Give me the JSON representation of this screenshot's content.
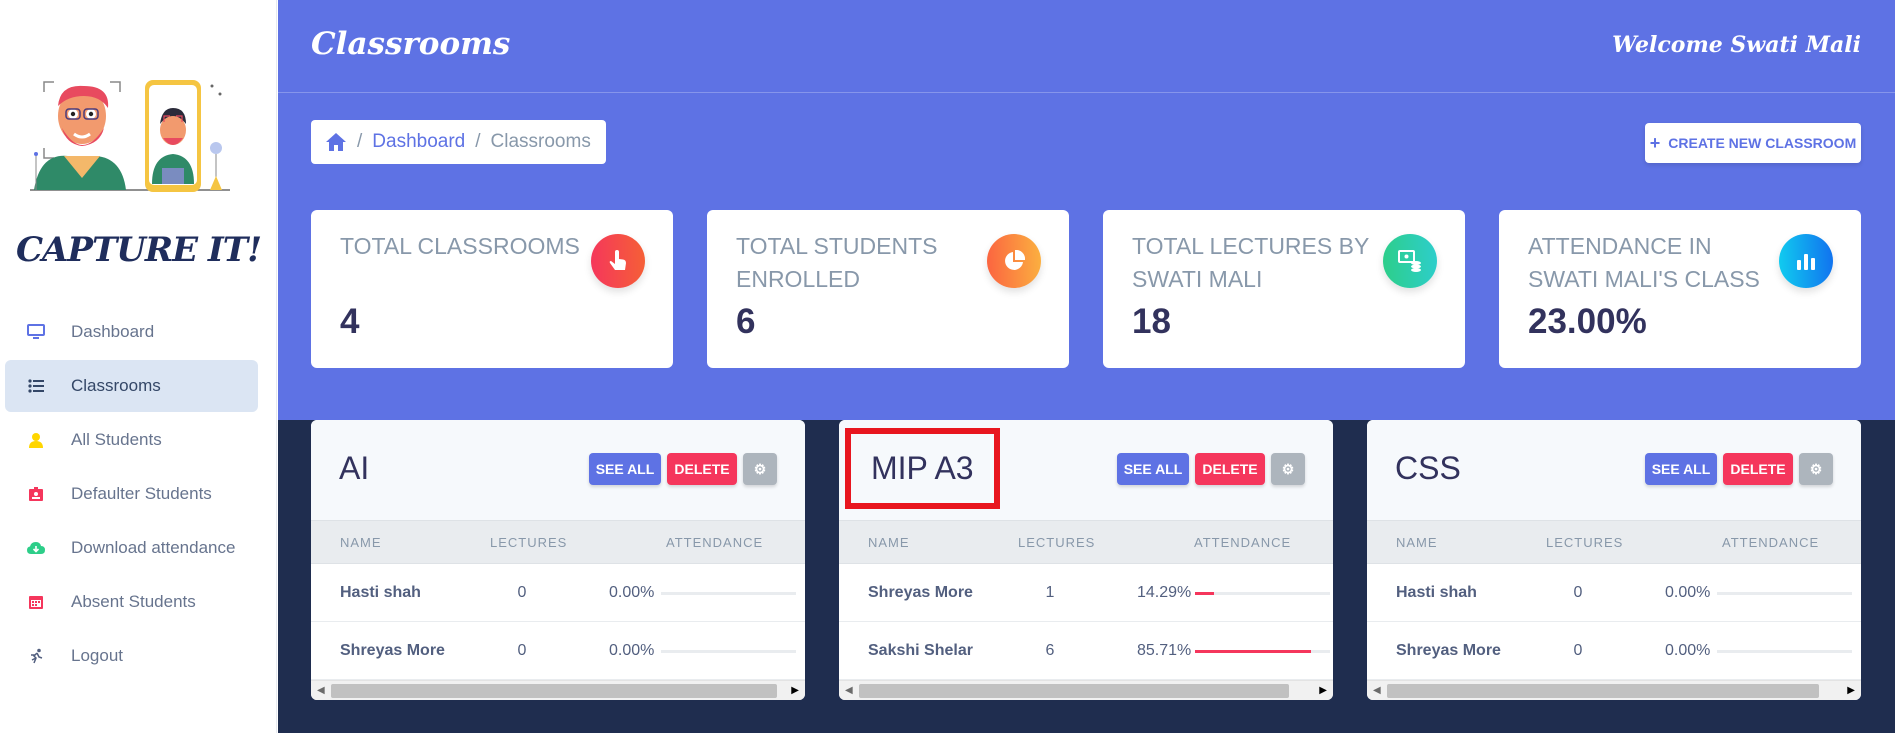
{
  "app": {
    "brand": "CAPTURE IT!",
    "page_title": "Classrooms",
    "welcome": "Welcome Swati Mali"
  },
  "sidebar": {
    "items": [
      {
        "label": "Dashboard",
        "icon": "monitor-icon",
        "active": false
      },
      {
        "label": "Classrooms",
        "icon": "list-icon",
        "active": true
      },
      {
        "label": "All Students",
        "icon": "user-icon",
        "active": false
      },
      {
        "label": "Defaulter Students",
        "icon": "id-badge-icon",
        "active": false
      },
      {
        "label": "Download attendance",
        "icon": "cloud-download-icon",
        "active": false
      },
      {
        "label": "Absent Students",
        "icon": "calendar-icon",
        "active": false
      },
      {
        "label": "Logout",
        "icon": "running-person-icon",
        "active": false
      }
    ]
  },
  "breadcrumb": {
    "home_icon": "home-icon",
    "items": [
      "Dashboard",
      "Classrooms"
    ]
  },
  "create_button": {
    "label": "CREATE NEW CLASSROOM",
    "icon": "plus-icon"
  },
  "stats": [
    {
      "title": "TOTAL CLASSROOMS",
      "value": "4",
      "icon": "hand-pointer-icon",
      "color": "#f5365c"
    },
    {
      "title": "TOTAL STUDENTS ENROLLED",
      "value": "6",
      "icon": "pie-chart-icon",
      "color": "#fb6340"
    },
    {
      "title": "TOTAL LECTURES BY SWATI MALI",
      "value": "18",
      "icon": "money-coins-icon",
      "color": "#2dce89"
    },
    {
      "title": "ATTENDANCE IN SWATI MALI'S CLASS",
      "value": "23.00%",
      "icon": "bar-chart-icon",
      "color": "#11cdef"
    }
  ],
  "table_headers": {
    "name": "NAME",
    "lectures": "LECTURES",
    "attendance": "ATTENDANCE"
  },
  "buttons": {
    "see_all": "SEE ALL",
    "delete": "DELETE",
    "settings_icon": "gear-icon"
  },
  "classes": [
    {
      "name": "AI",
      "rows": [
        {
          "name": "Hasti shah",
          "lectures": "0",
          "attendance": "0.00%",
          "fraction": 0.0
        },
        {
          "name": "Shreyas More",
          "lectures": "0",
          "attendance": "0.00%",
          "fraction": 0.0
        }
      ]
    },
    {
      "name": "MIP A3",
      "highlighted": true,
      "rows": [
        {
          "name": "Shreyas More",
          "lectures": "1",
          "attendance": "14.29%",
          "fraction": 0.1429
        },
        {
          "name": "Sakshi Shelar",
          "lectures": "6",
          "attendance": "85.71%",
          "fraction": 0.8571
        }
      ]
    },
    {
      "name": "CSS",
      "rows": [
        {
          "name": "Hasti shah",
          "lectures": "0",
          "attendance": "0.00%",
          "fraction": 0.0
        },
        {
          "name": "Shreyas More",
          "lectures": "0",
          "attendance": "0.00%",
          "fraction": 0.0
        }
      ]
    }
  ],
  "colors": {
    "primary": "#5e72e4",
    "danger": "#f5365c",
    "dark_bg": "#1f2d4f",
    "highlight_box": "#e8161f"
  }
}
